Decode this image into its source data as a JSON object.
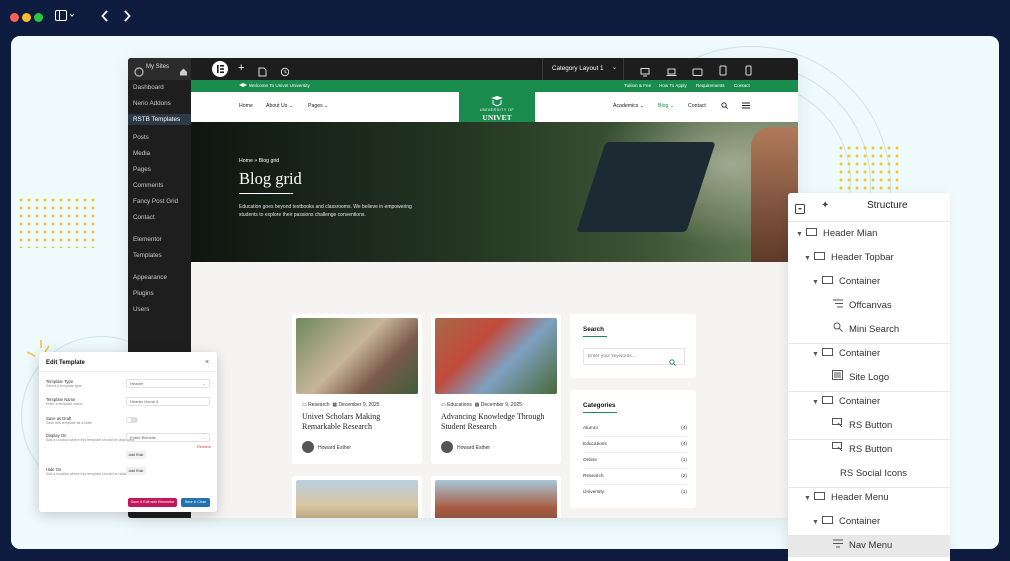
{
  "colors": {
    "brand_green": "#1a8c4e",
    "dark": "#1d1d1d",
    "blue": "#2271b1",
    "magenta": "#c2185b"
  },
  "wp_admin": {
    "site_label": "My Sites",
    "menu": [
      "Dashboard",
      "Nerio Addons",
      "RSTB Templates",
      "Posts",
      "Media",
      "Pages",
      "Comments",
      "Fancy Post Grid",
      "Contact",
      "Elementor",
      "Templates",
      "Appearance",
      "Plugins",
      "Users"
    ],
    "active_index": 2
  },
  "editor_toolbar": {
    "layout_label": "Category Layout 1"
  },
  "site": {
    "welcome": "Welcome To Univet University",
    "top_links": [
      "Tuition & Fee",
      "How To Apply",
      "Requirements",
      "Contact"
    ],
    "nav_left": [
      "Home",
      "About Us",
      "Pages"
    ],
    "nav_right": [
      "Academics",
      "Blog",
      "Contact"
    ],
    "logo_line1": "UNIVERSITY OF",
    "logo_line2": "UNIVET",
    "breadcrumb_home": "Home",
    "breadcrumb_current": "Blog grid",
    "hero_title": "Blog grid",
    "hero_text_1": "Education goes beyond textbooks and classrooms. We believe in empowering",
    "hero_text_2": "students to explore their passions challenge conventions."
  },
  "posts": [
    {
      "category": "Research",
      "date": "December 9, 2025",
      "title_1": "Univet Scholars Making",
      "title_2": "Remarkable Research",
      "author": "Howard Esther"
    },
    {
      "category": "Educations",
      "date": "December 9, 2025",
      "title_1": "Advancing Knowledge Through",
      "title_2": "Student Research",
      "author": "Howard Esther"
    }
  ],
  "search": {
    "heading": "Search",
    "placeholder": "Enter your keywords..."
  },
  "categories": {
    "heading": "Categories",
    "items": [
      {
        "name": "Alumni",
        "count": "(4)"
      },
      {
        "name": "Educations",
        "count": "(4)"
      },
      {
        "name": "Online",
        "count": "(1)"
      },
      {
        "name": "Research",
        "count": "(2)"
      },
      {
        "name": "University",
        "count": "(1)"
      }
    ]
  },
  "modal": {
    "title": "Edit Template",
    "type_label": "Template Type",
    "type_hint": "Select a template type.",
    "type_value": "Header",
    "name_label": "Template Name",
    "name_hint": "Enter a template name.",
    "name_value": "Header Home 4",
    "draft_label": "Save as Draft",
    "draft_hint": "Save this template as a draft.",
    "display_label": "Display On",
    "display_hint": "Add a location where this template should be displayed.",
    "display_value": "Entire Website",
    "remove_label": "Remove",
    "add_rule": "Add Rule",
    "hide_label": "Hide On",
    "hide_hint": "Add a location where this template should be hidden.",
    "btn_edit": "Save & Edit with Elementor",
    "btn_close": "Save & Close"
  },
  "structure": {
    "title": "Structure",
    "items": [
      {
        "label": "Header Mian",
        "level": 0,
        "arrow": true,
        "icon": "container"
      },
      {
        "label": "Header Topbar",
        "level": 1,
        "arrow": true,
        "icon": "container"
      },
      {
        "label": "Container",
        "level": 2,
        "arrow": true,
        "icon": "container"
      },
      {
        "label": "Offcanvas",
        "level": 3,
        "arrow": false,
        "icon": "offcanvas"
      },
      {
        "label": "Mini Search",
        "level": 3,
        "arrow": false,
        "icon": "search"
      },
      {
        "label": "Container",
        "level": 2,
        "arrow": true,
        "icon": "container"
      },
      {
        "label": "Site Logo",
        "level": 3,
        "arrow": false,
        "icon": "image"
      },
      {
        "label": "Container",
        "level": 2,
        "arrow": true,
        "icon": "container"
      },
      {
        "label": "RS Button",
        "level": 3,
        "arrow": false,
        "icon": "button"
      },
      {
        "label": "RS Button",
        "level": 3,
        "arrow": false,
        "icon": "button"
      },
      {
        "label": "RS Social Icons",
        "level": 3,
        "arrow": false,
        "icon": "none"
      },
      {
        "label": "Header Menu",
        "level": 1,
        "arrow": true,
        "icon": "container"
      },
      {
        "label": "Container",
        "level": 2,
        "arrow": true,
        "icon": "container"
      },
      {
        "label": "Nav Menu",
        "level": 3,
        "arrow": false,
        "icon": "menu"
      }
    ]
  }
}
